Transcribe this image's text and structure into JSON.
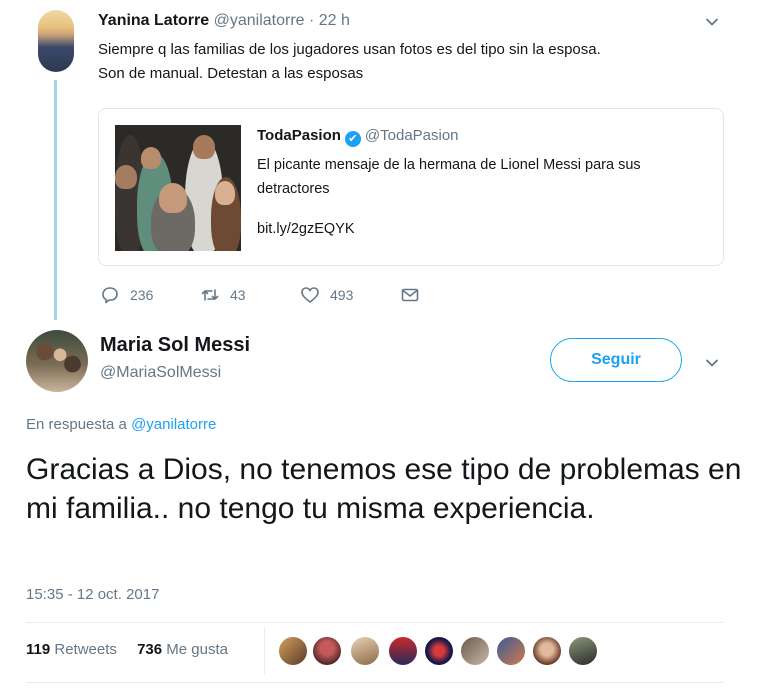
{
  "tweet1": {
    "name": "Yanina Latorre",
    "handle": "@yanilatorre",
    "separator": " · ",
    "time": "22 h",
    "text_line1": "Siempre q las familias de los jugadores usan fotos es del tipo sin la esposa.",
    "text_line2": "Son de manual. Detestan a las esposas",
    "card": {
      "name": "TodaPasion",
      "verified_icon": "✔",
      "handle": "@TodaPasion",
      "description": "El picante mensaje de la hermana de Lionel Messi para sus detractores",
      "link": "bit.ly/2gzEQYK"
    },
    "actions": {
      "replies": "236",
      "retweets": "43",
      "likes": "493"
    },
    "icons": [
      "reply-icon",
      "retweet-icon",
      "like-icon",
      "message-icon",
      "chevron-down-icon"
    ]
  },
  "tweet2": {
    "name": "Maria Sol Messi",
    "handle": "@MariaSolMessi",
    "follow_label": "Seguir",
    "reply_prefix": "En respuesta a ",
    "reply_handle": "@yanilatorre",
    "text": "Gracias a Dios, no tenemos ese tipo de problemas en mi familia.. no tengo tu misma experiencia.",
    "timestamp": "15:35 - 12 oct. 2017",
    "retweets_count": "119",
    "retweets_label": "Retweets",
    "likes_count": "736",
    "likes_label": "Me gusta",
    "liker_avatar_count": 10
  },
  "colors": {
    "accent": "#1da1f2",
    "secondary_text": "#657786",
    "thread_line": "#a3d3ef",
    "border": "#e1e8ed"
  }
}
